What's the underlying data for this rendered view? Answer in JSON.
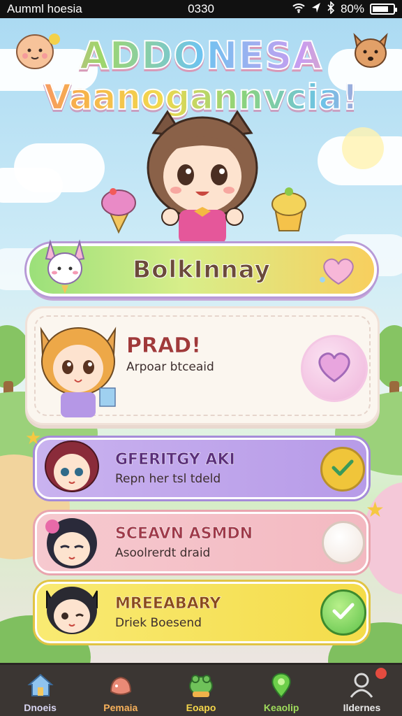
{
  "status_bar": {
    "carrier": "Aumml hoesia",
    "time": "0330",
    "battery": "80%"
  },
  "title": {
    "line1": "ADDONESA",
    "line2": "Vaanogannvcia!"
  },
  "main_button": {
    "label": "BolkInnay"
  },
  "featured_card": {
    "name": "PRAD!",
    "subtitle": "Arpoar btceaid",
    "action_icon": "heart-icon"
  },
  "list": [
    {
      "name": "GFERITGY AKI",
      "subtitle": "Repn her tsl tdeld",
      "color": "#b79be8",
      "status": "checked",
      "action_icon": "check-icon"
    },
    {
      "name": "SCEAVN ASMDN",
      "subtitle": "Asoolrerdt draid",
      "color": "#f3b9c1",
      "status": "empty",
      "action_icon": "circle-icon"
    },
    {
      "name": "MREEABARY",
      "subtitle": "Driek Boesend",
      "color": "#f4dc4a",
      "status": "checked",
      "action_icon": "check-icon"
    }
  ],
  "nav": [
    {
      "label": "Dnoeis",
      "icon": "home-icon",
      "color": "#d9d6f2"
    },
    {
      "label": "Pemaia",
      "icon": "bag-icon",
      "color": "#f7b15b"
    },
    {
      "label": "Eoapo",
      "icon": "frog-icon",
      "color": "#f4d64a"
    },
    {
      "label": "Keaolip",
      "icon": "pin-icon",
      "color": "#9fdc5c"
    },
    {
      "label": "Ildernes",
      "icon": "user-icon",
      "color": "#e9e9e9",
      "badge": true
    }
  ]
}
